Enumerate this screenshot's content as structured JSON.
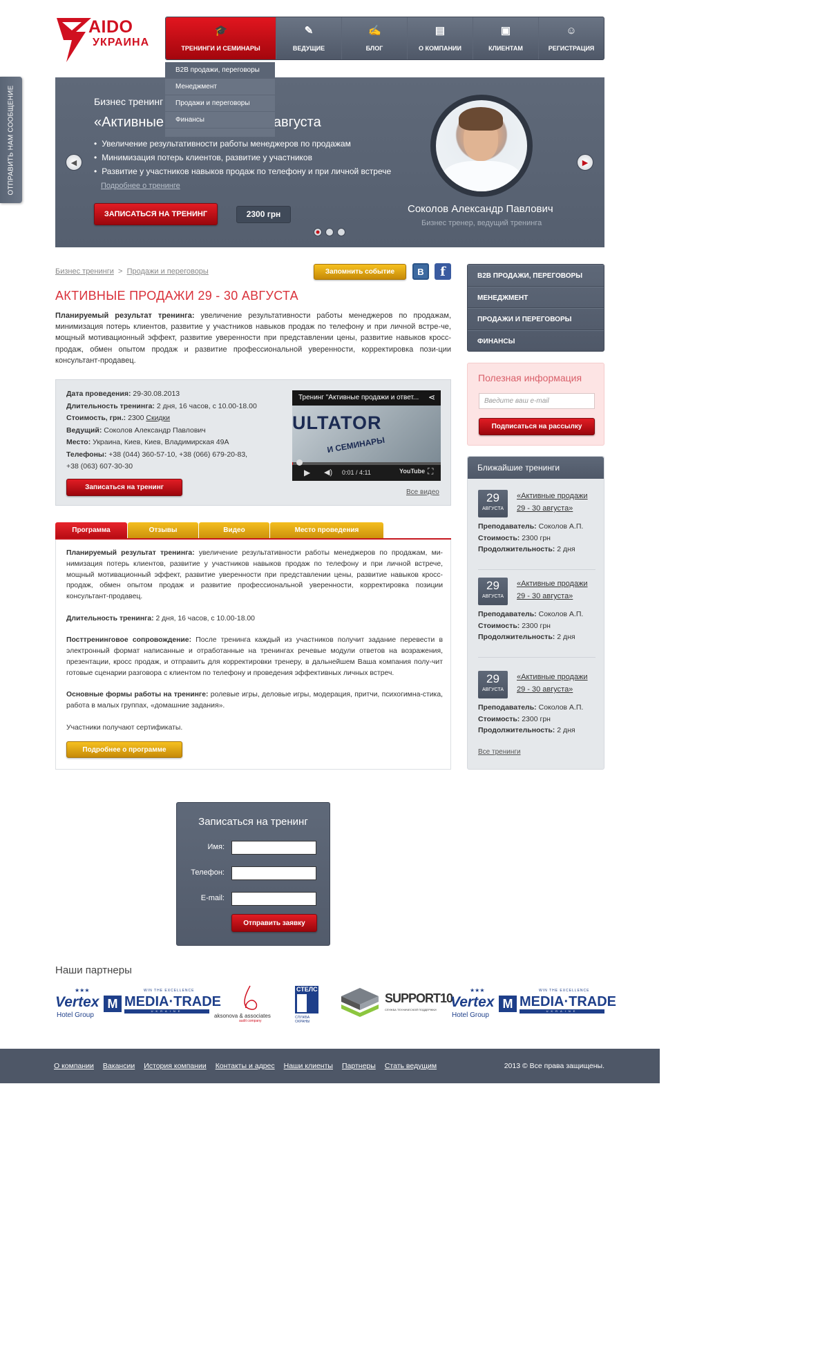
{
  "side_tab": {
    "label": "Отправить нам сообщение"
  },
  "logo": {
    "line1": "AIDO",
    "line2": "УКРАИНА"
  },
  "nav": {
    "items": [
      {
        "label": "Тренинги и семинары",
        "icon": "graduation-cap-icon"
      },
      {
        "label": "Ведущие",
        "icon": "presenter-icon"
      },
      {
        "label": "Блог",
        "icon": "pencil-note-icon"
      },
      {
        "label": "О компании",
        "icon": "id-card-icon"
      },
      {
        "label": "Клиентам",
        "icon": "briefcase-icon"
      },
      {
        "label": "Регистрация",
        "icon": "user-add-icon"
      }
    ],
    "dropdown": [
      "B2B продажи, переговоры",
      "Менеджмент",
      "Продажи и переговоры",
      "Финансы"
    ]
  },
  "hero": {
    "subtitle": "Бизнес тренинг",
    "title": "«Активные продажи» 29-30 августа",
    "bullets": [
      "Увеличение результативности  работы менеджеров по продажам",
      "Минимизация потерь клиентов, развитие у участников",
      "Развитие у участников навыков продаж по телефону и при личной встрече"
    ],
    "more_link": "Подробнее о тренинге",
    "signup_button": "Записаться на тренинг",
    "price": "2300 грн",
    "trainer_name": "Соколов Александр Павлович",
    "trainer_role": "Бизнес тренер, ведущий тренинга",
    "slides_total": 3,
    "slide_active": 1
  },
  "breadcrumbs": [
    "Бизнес тренинги",
    "Продажи и переговоры"
  ],
  "breadcrumb_sep": ">",
  "remember_button": "Запомнить событие",
  "social": {
    "vk": "В",
    "fb": "f"
  },
  "page_title": "Активные продажи 29 - 30 августа",
  "intro": {
    "label": "Планируемый результат тренинга:",
    "text": " увеличение результативности  работы менеджеров по продажам, минимизация потерь клиентов, развитие у участников навыков продаж по телефону и при личной встре-че, мощный мотивационный эффект, развитие уверенности при представлении цены, развитие навыков кросс-продаж, обмен опытом продаж и развитие профессиональной уверенности, корректировка пози-ции консультант-продавец."
  },
  "info": {
    "date_label": "Дата проведения:",
    "date": " 29-30.08.2013",
    "duration_label": "Длительность тренинга:",
    "duration": " 2 дня, 16 часов, с 10.00-18.00",
    "cost_label": "Стоимость, грн.:",
    "cost": " 2300 ",
    "discounts": "Скидки",
    "host_label": "Ведущий:",
    "host": " Соколов Александр Павлович",
    "place_label": "Место:",
    "place": " Украина, Киев, Киев, Владимирская 49А",
    "phones_label": "Телефоны:",
    "phones1": " +38 (044) 360-57-10, +38 (066) 679-20-83,",
    "phones2": "+38 (063) 607-30-30",
    "signup_button": "Записаться на тренинг",
    "all_video": "Все видео"
  },
  "video": {
    "title": "Тренинг \"Активные продажи и ответ...",
    "image_text": "ULTATOR",
    "image_text2": "И СЕМИНАРЫ",
    "time": "0:01 / 4:11",
    "youtube": "YouTube",
    "progress": 0.004
  },
  "tabs": [
    "Программа",
    "Отзывы",
    "Видео",
    "Место проведения"
  ],
  "program": {
    "p1_label": "Планируемый результат тренинга:",
    "p1": " увеличение результативности  работы менеджеров по продажам, ми-нимизация потерь клиентов, развитие у участников навыков продаж по телефону и при личной встрече, мощный мотивационный эффект, развитие уверенности при представлении цены, развитие навыков кросс-продаж, обмен опытом продаж и развитие профессиональной уверенности, корректировка позиции консультант-продавец.",
    "p2_label": "Длительность тренинга:",
    "p2": " 2 дня, 16 часов, с 10.00-18.00",
    "p3_label": "Посттренинговое сопровождение:",
    "p3": "  После тренинга каждый из участников получит задание перевести в электронный формат написанные и отработанные на тренингах речевые модули ответов на возражения, презентации, кросс продаж, и отправить для корректировки тренеру, в дальнейшем Ваша компания полу-чит готовые сценарии разговора с клиентом по телефону и проведения эффективных личных встреч.",
    "p4_label": "Основные формы работы на тренинге:",
    "p4": "  ролевые игры, деловые игры, модерация, притчи, психогимна-стика, работа в малых группах, «домашние задания».",
    "p5": "Участники получают сертификаты.",
    "more_button": "Подробнее о программе"
  },
  "sidebar_menu": [
    "B2B продажи, переговоры",
    "Менеджмент",
    "Продажи и переговоры",
    "Финансы"
  ],
  "useful": {
    "title": "Полезная информация",
    "email_placeholder": "Введите ваш e-mail",
    "subscribe_button": "Подписаться на рассылку"
  },
  "nearest": {
    "title": "Ближайшие тренинги",
    "events": [
      {
        "day": "29",
        "month": "августа",
        "title1": "«Активные продажи",
        "title2": "29 - 30 августа»",
        "teacher_label": "Преподаватель:",
        "teacher": " Соколов А.П.",
        "cost_label": "Стоимость:",
        "cost": " 2300 грн",
        "dur_label": "Продолжительность:",
        "dur": " 2 дня"
      },
      {
        "day": "29",
        "month": "августа",
        "title1": "«Активные продажи",
        "title2": "29 - 30 августа»",
        "teacher_label": "Преподаватель:",
        "teacher": " Соколов А.П.",
        "cost_label": "Стоимость:",
        "cost": " 2300 грн",
        "dur_label": "Продолжительность:",
        "dur": " 2 дня"
      },
      {
        "day": "29",
        "month": "августа",
        "title1": "«Активные продажи",
        "title2": "29 - 30 августа»",
        "teacher_label": "Преподаватель:",
        "teacher": " Соколов А.П.",
        "cost_label": "Стоимость:",
        "cost": " 2300 грн",
        "dur_label": "Продолжительность:",
        "dur": " 2 дня"
      }
    ],
    "all_link": "Все тренинги"
  },
  "form": {
    "title": "Записаться на тренинг",
    "name_label": "Имя:",
    "phone_label": "Телефон:",
    "email_label": "E-mail:",
    "submit": "Отправить заявку"
  },
  "partners": {
    "title": "Наши партнеры",
    "logos": [
      {
        "name": "Vertex",
        "sub": "Hotel Group"
      },
      {
        "name": "MEDIA·TRADE",
        "sub": "WIN THE EXCELLENCE",
        "sub2": "UKRAINE"
      },
      {
        "name": "aksonova & associates",
        "sub": "audit company"
      },
      {
        "name": "СТЕЛС",
        "sub": "СЛУЖБА ОХРАНЫ"
      },
      {
        "name": "SUPPORT10",
        "sub": "СЛУЖБА ТЕХНИЧЕСКОЙ ПОДДЕРЖКИ"
      },
      {
        "name": "Vertex",
        "sub": "Hotel Group"
      },
      {
        "name": "MEDIA·TRADE",
        "sub": "WIN THE EXCELLENCE",
        "sub2": "UKRAINE"
      }
    ]
  },
  "footer": {
    "links": [
      "О компании",
      "Вакансии",
      "История компании",
      "Контакты и адрес",
      "Наши клиенты",
      "Партнеры",
      "Стать ведущим"
    ],
    "copyright": "2013 © Все права защищены."
  },
  "colors": {
    "accent_red": "#d01020",
    "slate": "#555f6f",
    "gold": "#e3a812"
  }
}
